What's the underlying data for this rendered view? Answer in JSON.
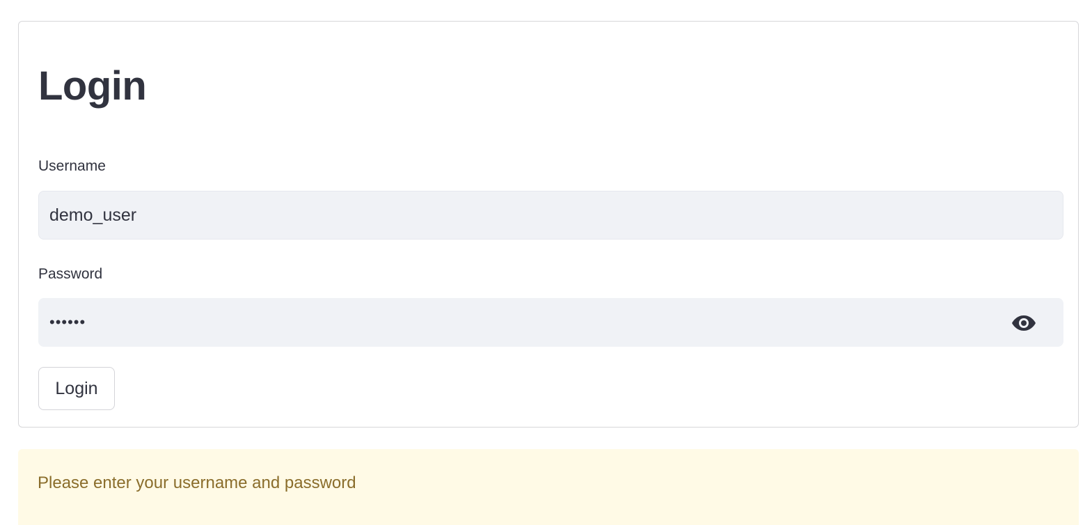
{
  "form": {
    "title": "Login",
    "username": {
      "label": "Username",
      "value": "demo_user"
    },
    "password": {
      "label": "Password",
      "value": "••••••",
      "toggle_icon": "eye-icon"
    },
    "submit_label": "Login"
  },
  "alert": {
    "message": "Please enter your username and password",
    "type": "warning"
  },
  "colors": {
    "text": "#31333f",
    "input_bg": "#f0f2f6",
    "alert_bg": "#fffae6",
    "alert_text": "#8a6d2b",
    "border": "#d6d6d9"
  }
}
